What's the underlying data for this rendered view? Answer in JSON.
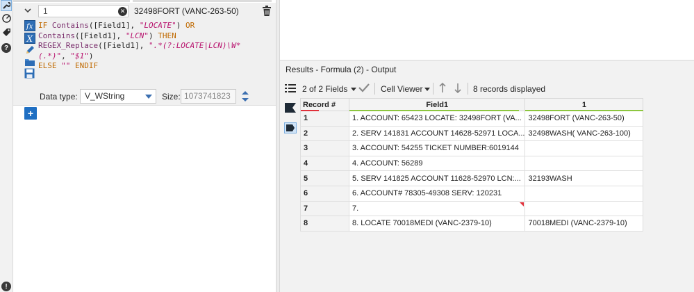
{
  "formula": {
    "field_value": "1",
    "preview": "32498FORT (VANC-263-50)",
    "expression_lines": [
      [
        {
          "t": "kw",
          "v": "IF "
        },
        {
          "t": "fn",
          "v": "Contains"
        },
        {
          "t": "tx",
          "v": "([Field1], "
        },
        {
          "t": "str",
          "v": "\"LOCATE\""
        },
        {
          "t": "tx",
          "v": ") "
        },
        {
          "t": "kw",
          "v": "OR"
        }
      ],
      [
        {
          "t": "fn",
          "v": "Contains"
        },
        {
          "t": "tx",
          "v": "([Field1], "
        },
        {
          "t": "str",
          "v": "\"LCN\""
        },
        {
          "t": "tx",
          "v": ") "
        },
        {
          "t": "kw",
          "v": "THEN"
        }
      ],
      [
        {
          "t": "fn",
          "v": "REGEX_Replace"
        },
        {
          "t": "tx",
          "v": "([Field1], "
        },
        {
          "t": "str",
          "v": "\".*(?:LOCATE|LCN)\\W*"
        }
      ],
      [
        {
          "t": "str",
          "v": "(.*)\""
        },
        {
          "t": "tx",
          "v": ", "
        },
        {
          "t": "str",
          "v": "\"$1\""
        },
        {
          "t": "tx",
          "v": ")"
        }
      ],
      [
        {
          "t": "kw",
          "v": "ELSE "
        },
        {
          "t": "op",
          "v": "\"\" "
        },
        {
          "t": "kw",
          "v": "ENDIF"
        }
      ]
    ],
    "data_type_label": "Data type:",
    "data_type_value": "V_WString",
    "size_label": "Size:",
    "size_value": "1073741823"
  },
  "results": {
    "title": "Results - Formula (2) - Output",
    "fields_selector": "2 of 2 Fields",
    "viewer": "Cell Viewer",
    "records_displayed": "8 records displayed",
    "columns": [
      "Record #",
      "Field1",
      "1"
    ],
    "column_bar_colors": [
      "#e0303a",
      "#8dc63f",
      "#8dc63f"
    ],
    "rows": [
      {
        "rec": "1",
        "field1": "1.  ACCOUNT: 65423 LOCATE: 32498FORT (VA...",
        "out": "32498FORT (VANC-263-50)",
        "flag": false
      },
      {
        "rec": "2",
        "field1": "2.  SERV 141831 ACCOUNT 14628-52971 LOCA...",
        "out": "32498WASH( VANC-263-100)",
        "flag": false
      },
      {
        "rec": "3",
        "field1": "3.  ACCOUNT: 54255 TICKET NUMBER:6019144",
        "out": "",
        "flag": false
      },
      {
        "rec": "4",
        "field1": "4.  ACCOUNT: 56289",
        "out": "",
        "flag": false
      },
      {
        "rec": "5",
        "field1": "5.  SERV 141825 ACCOUNT 11628-52970 LCN:...",
        "out": "32193WASH",
        "flag": false
      },
      {
        "rec": "6",
        "field1": "6.  ACCOUNT# 78305-49308 SERV: 120231",
        "out": "",
        "flag": false
      },
      {
        "rec": "7",
        "field1": "7.",
        "out": "",
        "flag": true
      },
      {
        "rec": "8",
        "field1": "8.  LOCATE 70018MEDI (VANC-2379-10)",
        "out": "70018MEDI (VANC-2379-10)",
        "flag": false
      }
    ]
  },
  "colors": {
    "accent": "#1f6fc3",
    "keyword": "#c06a00",
    "function": "#7a2e6c",
    "string": "#b8136e"
  }
}
